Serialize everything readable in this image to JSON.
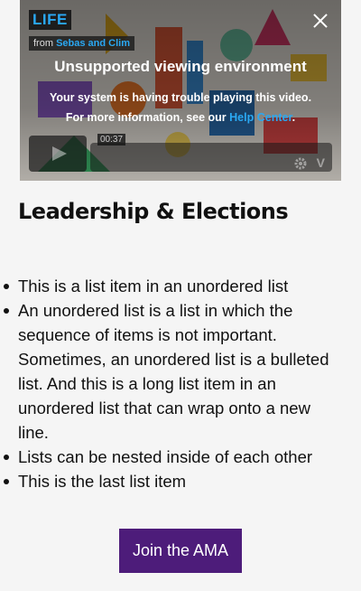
{
  "video": {
    "logo": "LIFE",
    "byline_from": "from",
    "byline_author": "Sebas and Clim",
    "error_title": "Unsupported viewing environment",
    "error_line1": "Your system is having trouble playing this video.",
    "error_line2_prefix": "For more information, see our ",
    "error_link": "Help Center",
    "error_line2_suffix": ".",
    "timestamp": "00:37",
    "vimeo_glyph": "V"
  },
  "content": {
    "heading": "Leadership & Elections",
    "list_items": [
      "This is a list item in an unordered list",
      "An unordered list is a list in which the sequence of items is not important. Sometimes, an unordered list is a bulleted list. And this is a long list item in an unordered list that can wrap onto a new line.",
      "Lists can be nested inside of each other",
      "This is the last list item"
    ],
    "cta_label": "Join the AMA"
  },
  "colors": {
    "cta_background": "#4d1c7a",
    "link": "#2aa8f2"
  }
}
